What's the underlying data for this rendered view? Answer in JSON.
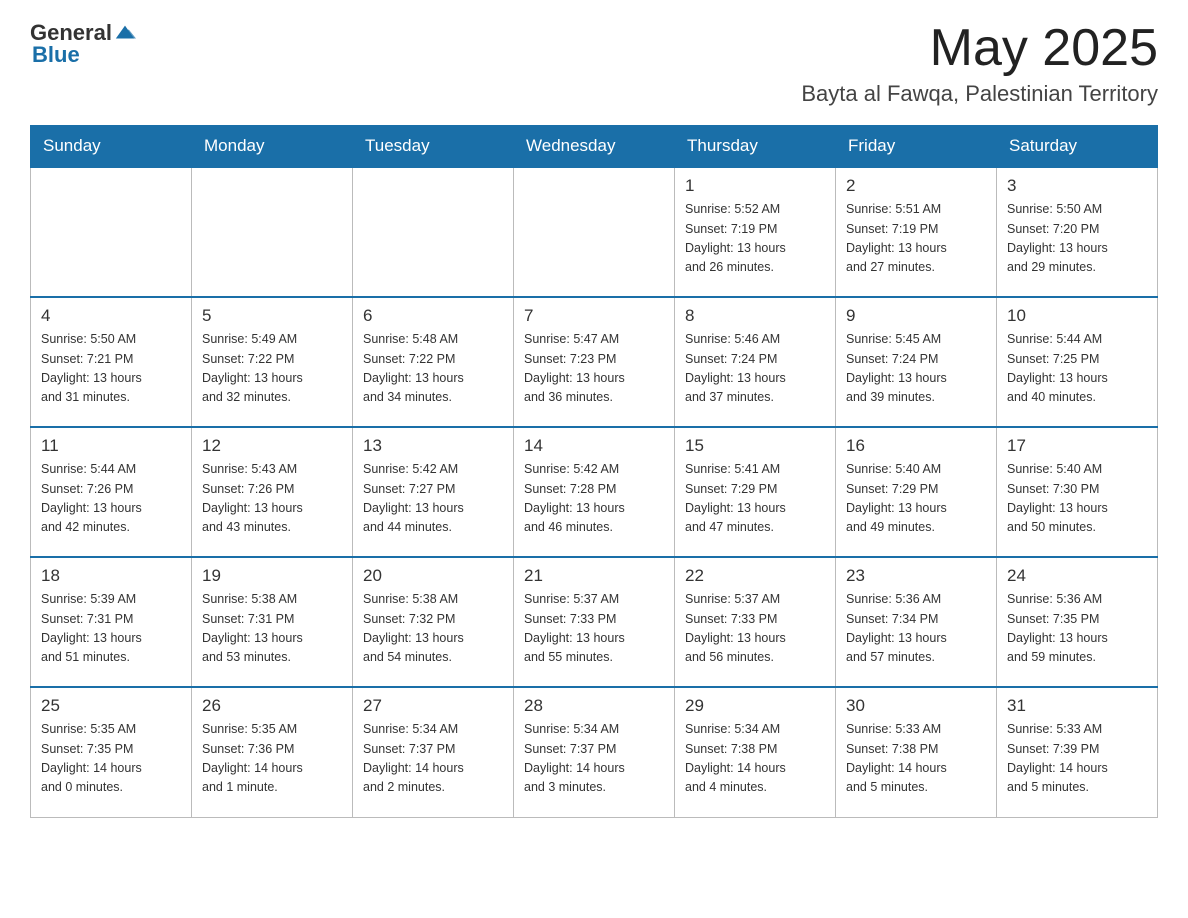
{
  "header": {
    "logo_general": "General",
    "logo_blue": "Blue",
    "month_title": "May 2025",
    "location": "Bayta al Fawqa, Palestinian Territory"
  },
  "weekdays": [
    "Sunday",
    "Monday",
    "Tuesday",
    "Wednesday",
    "Thursday",
    "Friday",
    "Saturday"
  ],
  "weeks": [
    [
      {
        "day": "",
        "info": ""
      },
      {
        "day": "",
        "info": ""
      },
      {
        "day": "",
        "info": ""
      },
      {
        "day": "",
        "info": ""
      },
      {
        "day": "1",
        "info": "Sunrise: 5:52 AM\nSunset: 7:19 PM\nDaylight: 13 hours\nand 26 minutes."
      },
      {
        "day": "2",
        "info": "Sunrise: 5:51 AM\nSunset: 7:19 PM\nDaylight: 13 hours\nand 27 minutes."
      },
      {
        "day": "3",
        "info": "Sunrise: 5:50 AM\nSunset: 7:20 PM\nDaylight: 13 hours\nand 29 minutes."
      }
    ],
    [
      {
        "day": "4",
        "info": "Sunrise: 5:50 AM\nSunset: 7:21 PM\nDaylight: 13 hours\nand 31 minutes."
      },
      {
        "day": "5",
        "info": "Sunrise: 5:49 AM\nSunset: 7:22 PM\nDaylight: 13 hours\nand 32 minutes."
      },
      {
        "day": "6",
        "info": "Sunrise: 5:48 AM\nSunset: 7:22 PM\nDaylight: 13 hours\nand 34 minutes."
      },
      {
        "day": "7",
        "info": "Sunrise: 5:47 AM\nSunset: 7:23 PM\nDaylight: 13 hours\nand 36 minutes."
      },
      {
        "day": "8",
        "info": "Sunrise: 5:46 AM\nSunset: 7:24 PM\nDaylight: 13 hours\nand 37 minutes."
      },
      {
        "day": "9",
        "info": "Sunrise: 5:45 AM\nSunset: 7:24 PM\nDaylight: 13 hours\nand 39 minutes."
      },
      {
        "day": "10",
        "info": "Sunrise: 5:44 AM\nSunset: 7:25 PM\nDaylight: 13 hours\nand 40 minutes."
      }
    ],
    [
      {
        "day": "11",
        "info": "Sunrise: 5:44 AM\nSunset: 7:26 PM\nDaylight: 13 hours\nand 42 minutes."
      },
      {
        "day": "12",
        "info": "Sunrise: 5:43 AM\nSunset: 7:26 PM\nDaylight: 13 hours\nand 43 minutes."
      },
      {
        "day": "13",
        "info": "Sunrise: 5:42 AM\nSunset: 7:27 PM\nDaylight: 13 hours\nand 44 minutes."
      },
      {
        "day": "14",
        "info": "Sunrise: 5:42 AM\nSunset: 7:28 PM\nDaylight: 13 hours\nand 46 minutes."
      },
      {
        "day": "15",
        "info": "Sunrise: 5:41 AM\nSunset: 7:29 PM\nDaylight: 13 hours\nand 47 minutes."
      },
      {
        "day": "16",
        "info": "Sunrise: 5:40 AM\nSunset: 7:29 PM\nDaylight: 13 hours\nand 49 minutes."
      },
      {
        "day": "17",
        "info": "Sunrise: 5:40 AM\nSunset: 7:30 PM\nDaylight: 13 hours\nand 50 minutes."
      }
    ],
    [
      {
        "day": "18",
        "info": "Sunrise: 5:39 AM\nSunset: 7:31 PM\nDaylight: 13 hours\nand 51 minutes."
      },
      {
        "day": "19",
        "info": "Sunrise: 5:38 AM\nSunset: 7:31 PM\nDaylight: 13 hours\nand 53 minutes."
      },
      {
        "day": "20",
        "info": "Sunrise: 5:38 AM\nSunset: 7:32 PM\nDaylight: 13 hours\nand 54 minutes."
      },
      {
        "day": "21",
        "info": "Sunrise: 5:37 AM\nSunset: 7:33 PM\nDaylight: 13 hours\nand 55 minutes."
      },
      {
        "day": "22",
        "info": "Sunrise: 5:37 AM\nSunset: 7:33 PM\nDaylight: 13 hours\nand 56 minutes."
      },
      {
        "day": "23",
        "info": "Sunrise: 5:36 AM\nSunset: 7:34 PM\nDaylight: 13 hours\nand 57 minutes."
      },
      {
        "day": "24",
        "info": "Sunrise: 5:36 AM\nSunset: 7:35 PM\nDaylight: 13 hours\nand 59 minutes."
      }
    ],
    [
      {
        "day": "25",
        "info": "Sunrise: 5:35 AM\nSunset: 7:35 PM\nDaylight: 14 hours\nand 0 minutes."
      },
      {
        "day": "26",
        "info": "Sunrise: 5:35 AM\nSunset: 7:36 PM\nDaylight: 14 hours\nand 1 minute."
      },
      {
        "day": "27",
        "info": "Sunrise: 5:34 AM\nSunset: 7:37 PM\nDaylight: 14 hours\nand 2 minutes."
      },
      {
        "day": "28",
        "info": "Sunrise: 5:34 AM\nSunset: 7:37 PM\nDaylight: 14 hours\nand 3 minutes."
      },
      {
        "day": "29",
        "info": "Sunrise: 5:34 AM\nSunset: 7:38 PM\nDaylight: 14 hours\nand 4 minutes."
      },
      {
        "day": "30",
        "info": "Sunrise: 5:33 AM\nSunset: 7:38 PM\nDaylight: 14 hours\nand 5 minutes."
      },
      {
        "day": "31",
        "info": "Sunrise: 5:33 AM\nSunset: 7:39 PM\nDaylight: 14 hours\nand 5 minutes."
      }
    ]
  ]
}
